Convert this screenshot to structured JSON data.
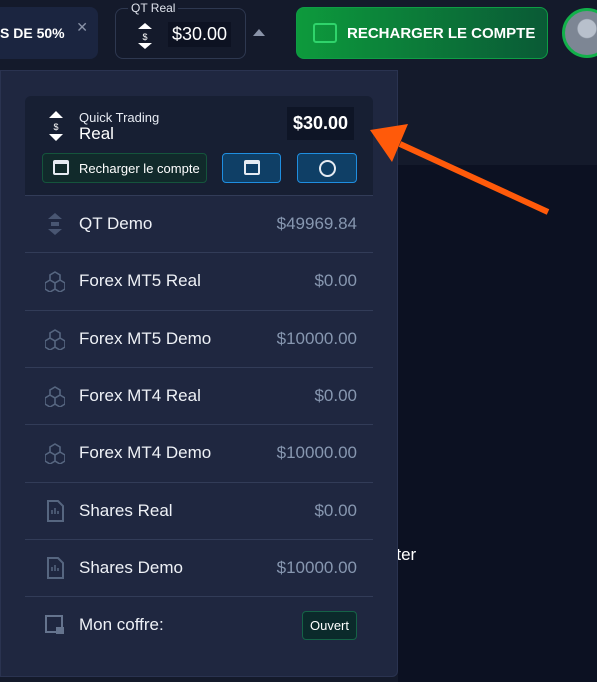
{
  "topbar": {
    "promo_text": "S DE 50%",
    "close_label": "✕",
    "account_label": "QT Real",
    "account_balance": "$30.00",
    "recharge_label": "RECHARGER LE COMPTE"
  },
  "dropdown": {
    "current": {
      "platform": "Quick Trading",
      "type": "Real",
      "balance": "$30.00",
      "recharge_label": "Recharger le compte"
    },
    "accounts": [
      {
        "name": "QT Demo",
        "balance": "$49969.84",
        "icon": "switch-arrows-icon"
      },
      {
        "name": "Forex MT5 Real",
        "balance": "$0.00",
        "icon": "cubes-icon"
      },
      {
        "name": "Forex MT5 Demo",
        "balance": "$10000.00",
        "icon": "cubes-icon"
      },
      {
        "name": "Forex MT4 Real",
        "balance": "$0.00",
        "icon": "cubes-icon"
      },
      {
        "name": "Forex MT4 Demo",
        "balance": "$10000.00",
        "icon": "cubes-icon"
      },
      {
        "name": "Shares Real",
        "balance": "$0.00",
        "icon": "document-chart-icon"
      },
      {
        "name": "Shares Demo",
        "balance": "$10000.00",
        "icon": "document-chart-icon"
      }
    ],
    "vault": {
      "label": "Mon coffre:",
      "button": "Ouvert"
    }
  },
  "background": {
    "partial_text": "nenter"
  },
  "colors": {
    "accent_green": "#0e9d45",
    "arrow": "#ff5a0a",
    "button_blue": "#1f8ee0"
  }
}
